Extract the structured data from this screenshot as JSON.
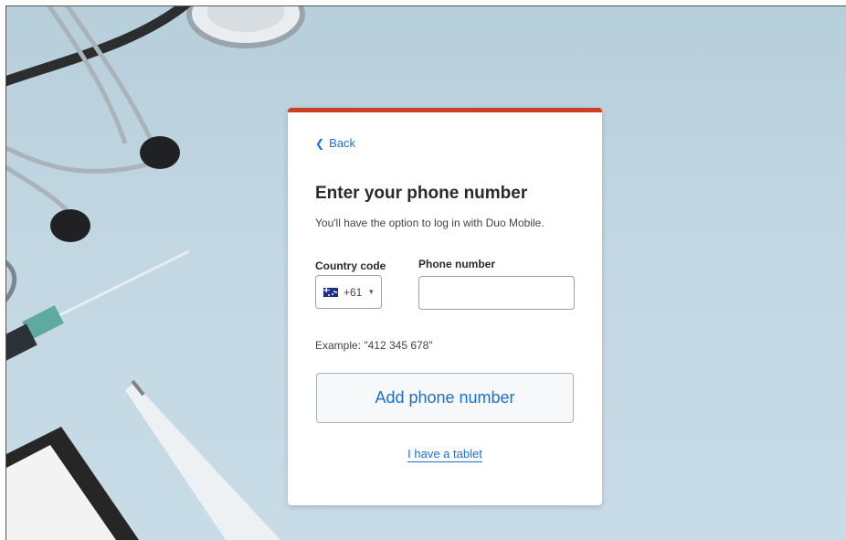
{
  "card": {
    "accent_color": "#cf3d22",
    "back_icon": "chevron-left-icon",
    "back_label": "Back",
    "title": "Enter your phone number",
    "subtitle": "You'll have the option to log in with Duo Mobile.",
    "country_code_label": "Country code",
    "phone_number_label": "Phone number",
    "country_select": {
      "flag": "australia-flag-icon",
      "selected_value": "+61",
      "caret_icon": "caret-down-icon"
    },
    "phone_input": {
      "value": "",
      "placeholder": ""
    },
    "example_text": "Example: \"412 345 678\"",
    "add_button_label": "Add phone number",
    "tablet_link_label": "I have a tablet",
    "link_color": "#1c6fd0"
  }
}
